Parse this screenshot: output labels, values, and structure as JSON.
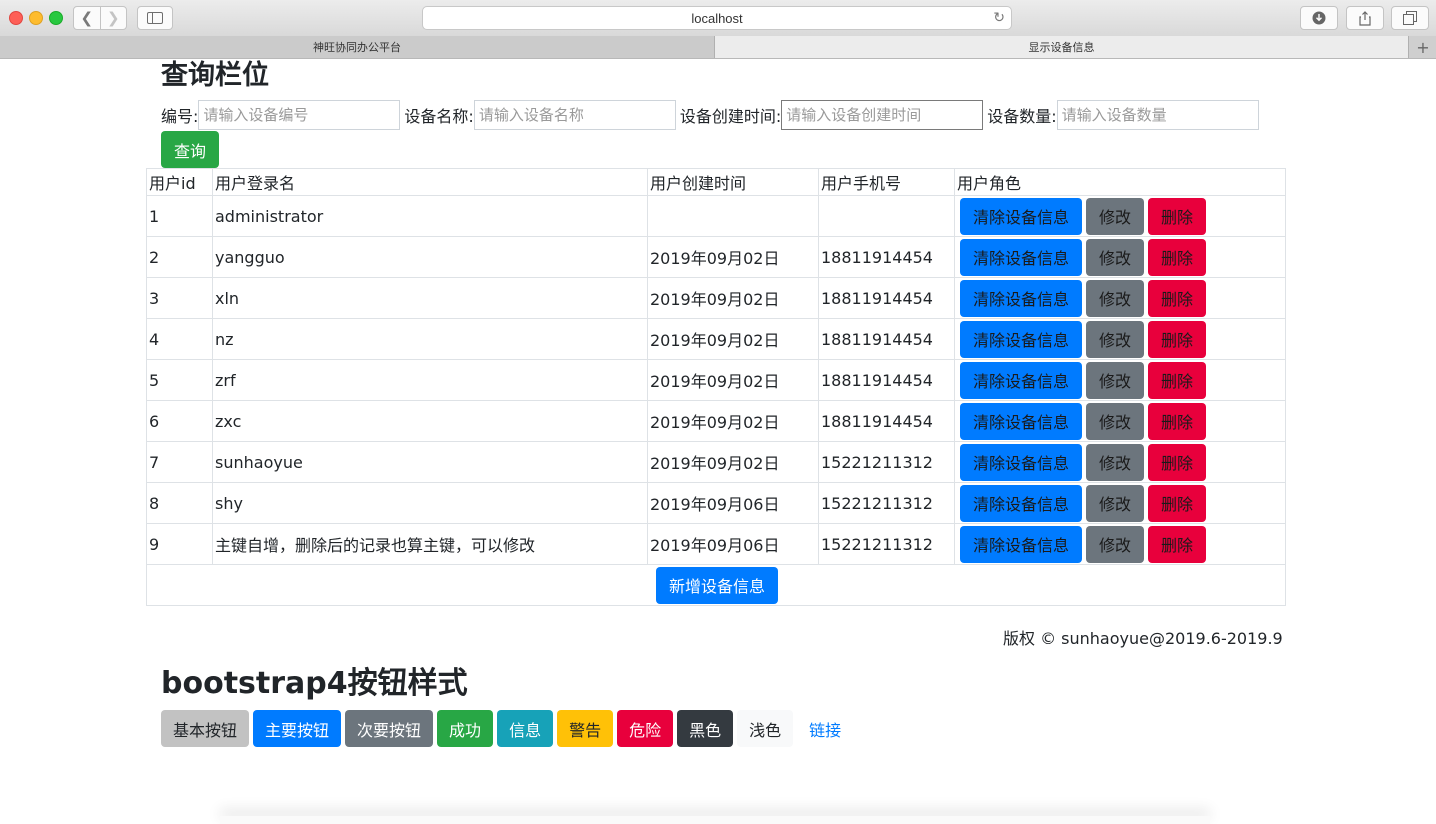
{
  "browser": {
    "url": "localhost",
    "tabs": [
      "神旺协同办公平台",
      "显示设备信息"
    ],
    "new_tab": "+"
  },
  "query": {
    "title": "查询栏位",
    "fields": [
      {
        "label": "编号:",
        "placeholder": "请输入设备编号"
      },
      {
        "label": "设备名称:",
        "placeholder": "请输入设备名称"
      },
      {
        "label": "设备创建时间:",
        "placeholder": "请输入设备创建时间"
      },
      {
        "label": "设备数量:",
        "placeholder": "请输入设备数量"
      }
    ],
    "submit": "查询"
  },
  "table": {
    "headers": [
      "用户id",
      "用户登录名",
      "用户创建时间",
      "用户手机号",
      "用户角色"
    ],
    "rows": [
      {
        "id": "1",
        "name": "administrator",
        "created": "",
        "phone": ""
      },
      {
        "id": "2",
        "name": "yangguo",
        "created": "2019年09月02日",
        "phone": "18811914454"
      },
      {
        "id": "3",
        "name": "xln",
        "created": "2019年09月02日",
        "phone": "18811914454"
      },
      {
        "id": "4",
        "name": "nz",
        "created": "2019年09月02日",
        "phone": "18811914454"
      },
      {
        "id": "5",
        "name": "zrf",
        "created": "2019年09月02日",
        "phone": "18811914454"
      },
      {
        "id": "6",
        "name": "zxc",
        "created": "2019年09月02日",
        "phone": "18811914454"
      },
      {
        "id": "7",
        "name": "sunhaoyue",
        "created": "2019年09月02日",
        "phone": "15221211312"
      },
      {
        "id": "8",
        "name": "shy",
        "created": "2019年09月06日",
        "phone": "15221211312"
      },
      {
        "id": "9",
        "name": "主键自增，删除后的记录也算主键，可以修改",
        "created": "2019年09月06日",
        "phone": "15221211312"
      }
    ],
    "actions": {
      "clear": "清除设备信息",
      "edit": "修改",
      "delete": "删除"
    },
    "add": "新增设备信息"
  },
  "copyright": "版权 © sunhaoyue@2019.6-2019.9",
  "bootstrap": {
    "title": "bootstrap4按钮样式",
    "buttons": [
      "基本按钮",
      "主要按钮",
      "次要按钮",
      "成功",
      "信息",
      "警告",
      "危险",
      "黑色",
      "浅色",
      "链接"
    ]
  },
  "colors": {
    "primary": "#007bff",
    "secondary": "#6c757d",
    "success": "#28a745",
    "info": "#17a2b8",
    "warning": "#ffc107",
    "danger": "#e8003c",
    "dark": "#343a40",
    "light": "#f8f9fa"
  }
}
